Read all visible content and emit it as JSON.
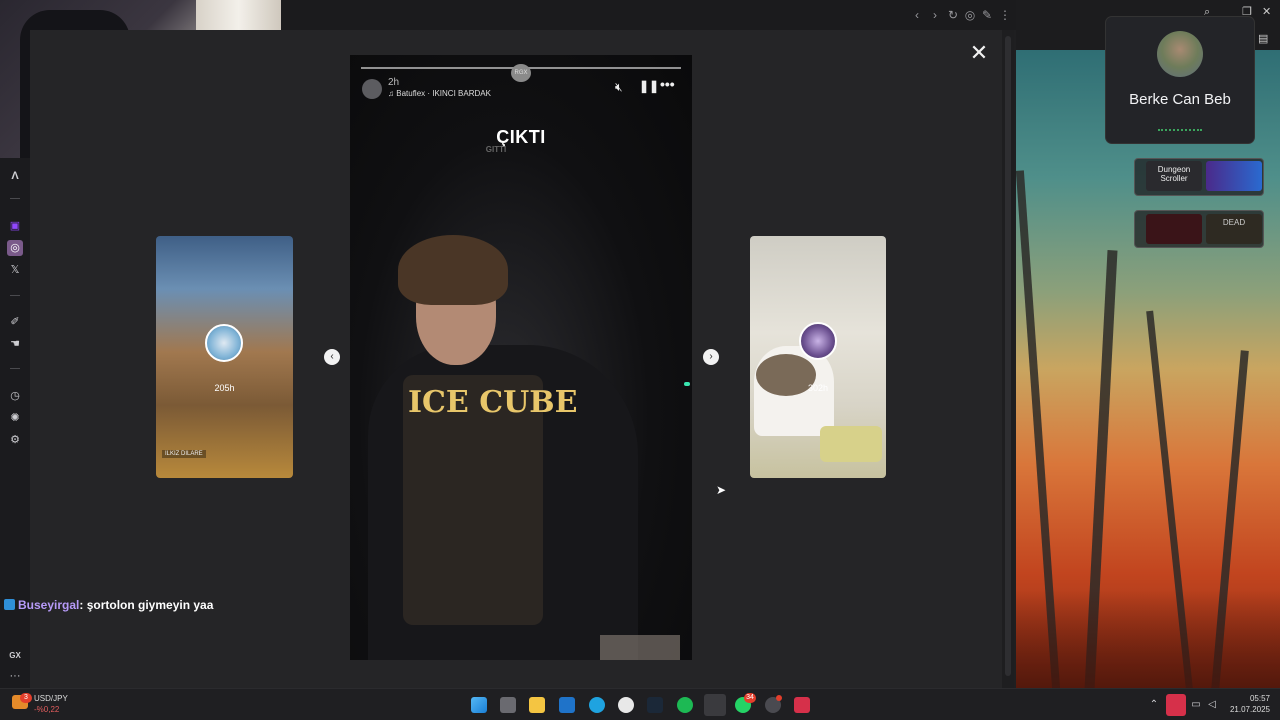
{
  "story": {
    "username": "Batuflex",
    "time_ago": "2h",
    "music": "IKINCI BARDAK",
    "caption": "ÇIKTI",
    "caption_shadow": "GITTI",
    "watermark": "RGX",
    "shirt_print": "ICE CUBE"
  },
  "prev_story": {
    "time_ago": "205h",
    "tag": "ILKIZ DILARE"
  },
  "next_story": {
    "time_ago": "302h"
  },
  "chat": {
    "user": "Buseyirgal",
    "message": ": şortolon giymeyin yaa"
  },
  "discord": {
    "name": "Berke Can Beb"
  },
  "games": [
    {
      "label": "Dungeon Scroller"
    },
    {
      "label": ""
    },
    {
      "label": ""
    },
    {
      "label": "DEAD"
    }
  ],
  "sidebar": {
    "bottom_label": "GX"
  },
  "ticker": {
    "pair": "USD/JPY",
    "change": "-%0,22",
    "badge": "3"
  },
  "taskbar": {
    "whatsapp_badge": "34"
  },
  "clock": {
    "time": "05:57",
    "date": "21.07.2025"
  },
  "colors": {
    "accent_purple": "#b69af7",
    "badge_red": "#e43e2b",
    "discord_green": "#3ba55d"
  }
}
